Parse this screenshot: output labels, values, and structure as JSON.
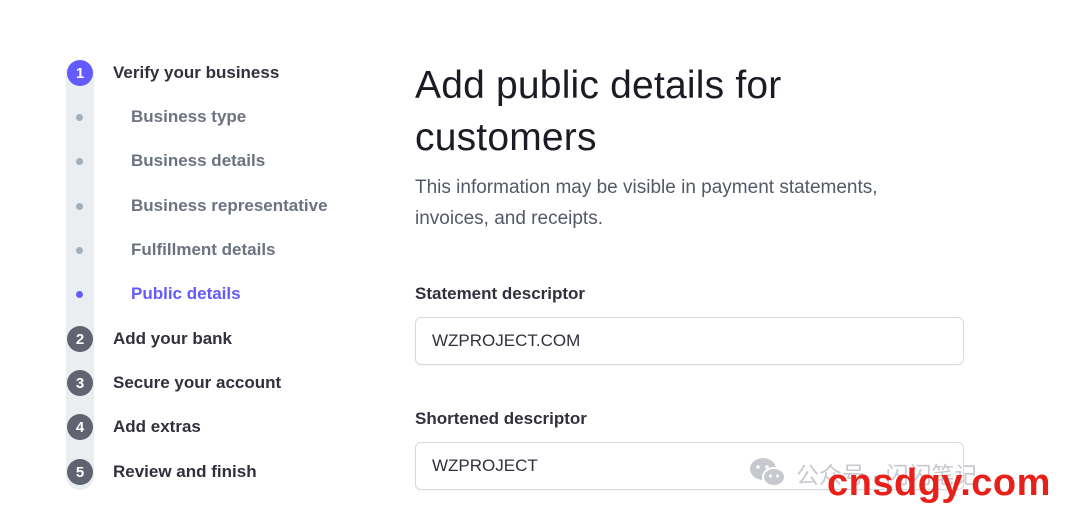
{
  "sidebar": {
    "steps": [
      {
        "number": "1",
        "label": "Verify your business",
        "active": true
      },
      {
        "number": "2",
        "label": "Add your bank",
        "active": false
      },
      {
        "number": "3",
        "label": "Secure your account",
        "active": false
      },
      {
        "number": "4",
        "label": "Add extras",
        "active": false
      },
      {
        "number": "5",
        "label": "Review and finish",
        "active": false
      }
    ],
    "substeps": [
      {
        "label": "Business type",
        "active": false
      },
      {
        "label": "Business details",
        "active": false
      },
      {
        "label": "Business representative",
        "active": false
      },
      {
        "label": "Fulfillment details",
        "active": false
      },
      {
        "label": "Public details",
        "active": true
      }
    ]
  },
  "main": {
    "title": "Add public details for customers",
    "subtitle": "This information may be visible in payment statements, invoices, and receipts.",
    "fields": [
      {
        "label": "Statement descriptor",
        "value": "WZPROJECT.COM"
      },
      {
        "label": "Shortened descriptor",
        "value": "WZPROJECT"
      }
    ]
  },
  "watermark": {
    "account_text": "公众号 · 闪闪笔记",
    "site": "cnsdgy.com"
  },
  "colors": {
    "accent": "#635bff",
    "step_inactive": "#5f6470",
    "brand_watermark": "#e8201a"
  }
}
